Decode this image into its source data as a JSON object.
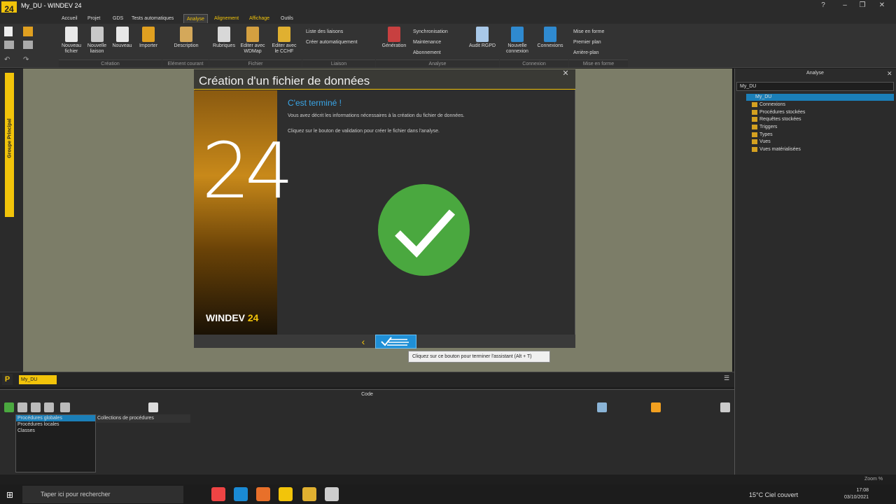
{
  "window": {
    "title": "My_DU - WINDEV 24",
    "logo": "24"
  },
  "menu": {
    "tabs": [
      "Accueil",
      "Projet",
      "GDS",
      "Tests automatiques",
      "Analyse",
      "Alignement",
      "Affichage",
      "Outils"
    ],
    "active": "Analyse"
  },
  "ribbon": {
    "buttons": [
      "Nouveau fichier",
      "Nouvelle liaison",
      "Nouveau",
      "Importer",
      "Description",
      "Rubriques",
      "Editer avec WDMap",
      "Editer avec le CCHF",
      "Génération",
      "Audit RGPD",
      "Nouvelle connexion",
      "Connexions"
    ],
    "small": [
      "Liste des liaisons",
      "Créer automatiquement",
      "Synchronisation",
      "Maintenance",
      "Abonnement",
      "Mise en forme",
      "Premier plan",
      "Arrière-plan"
    ],
    "groups": [
      "Création",
      "Elément courant",
      "Fichier",
      "Liaison",
      "Analyse",
      "Connexion",
      "Mise en forme"
    ]
  },
  "left_strip": {
    "group_label": "Groupe Principal"
  },
  "dialog": {
    "title": "Création d'un fichier de données",
    "heading": "C'est terminé !",
    "para1": "Vous avez décrit les informations nécessaires à la création du fichier de données.",
    "para2": "Cliquez sur le bouton de validation pour créer le fichier dans l'analyse.",
    "banner_number": "24",
    "banner_brand": "WINDEV",
    "banner_brand_num": "24",
    "tooltip": "Cliquez sur ce bouton pour terminer l'assistant (Alt + T)",
    "check_color": "#4aa83f"
  },
  "analysis_panel": {
    "title": "Analyse",
    "search": "My_DU",
    "tree_root": "My_DU",
    "tree_items": [
      "Connexions",
      "Procédures stockées",
      "Requêtes stockées",
      "Triggers",
      "Types",
      "Vues",
      "Vues matérialisées"
    ]
  },
  "bottom": {
    "p_label": "P",
    "doc_tab": "My_DU"
  },
  "code_panel": {
    "title": "Code",
    "items": [
      "Procédures globales",
      "Procédures locales",
      "Classes"
    ],
    "collections": "Collections de procédures"
  },
  "taskbar": {
    "search": "Taper ici pour rechercher",
    "weather": "15°C  Ciel couvert",
    "time": "17:08",
    "date": "03/10/2021",
    "zoom": "Zoom %"
  }
}
